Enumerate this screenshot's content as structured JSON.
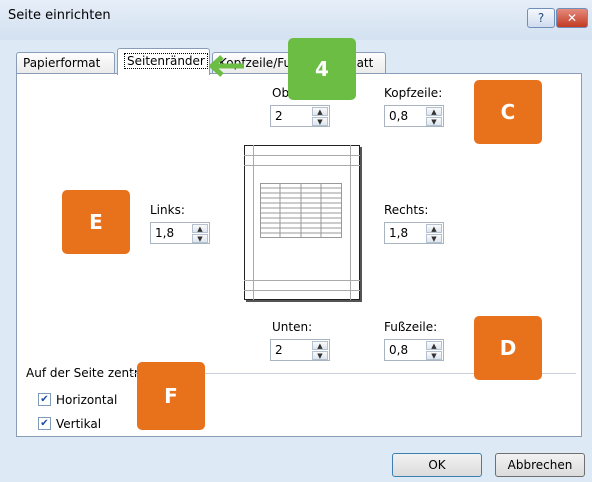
{
  "window": {
    "title": "Seite einrichten",
    "help_label": "?",
    "close_label": "✕"
  },
  "tabs": [
    {
      "label": "Papierformat"
    },
    {
      "label": "Seitenränder"
    },
    {
      "label": "Kopfzeile/Fußzeile"
    },
    {
      "label": "Blatt"
    }
  ],
  "margins": {
    "oben": {
      "label": "Oben:",
      "value": "2"
    },
    "kopfzeile": {
      "label": "Kopfzeile:",
      "value": "0,8"
    },
    "links": {
      "label": "Links:",
      "value": "1,8"
    },
    "rechts": {
      "label": "Rechts:",
      "value": "1,8"
    },
    "unten": {
      "label": "Unten:",
      "value": "2"
    },
    "fusszeile": {
      "label": "Fußzeile:",
      "value": "0,8"
    }
  },
  "center": {
    "legend": "Auf der Seite zentrieren",
    "horizontal": {
      "label": "Horizontal",
      "checked": true
    },
    "vertikal": {
      "label": "Vertikal",
      "checked": true
    }
  },
  "buttons": {
    "ok": "OK",
    "cancel": "Abbrechen"
  },
  "annotations": {
    "step": "4",
    "c": "C",
    "d": "D",
    "e": "E",
    "f": "F"
  },
  "colors": {
    "badge_orange": "#e8711c",
    "badge_green": "#6cbd43"
  },
  "icons": {
    "arrow": "left-arrow-icon",
    "spin_up": "spin-up-icon",
    "spin_down": "spin-down-icon",
    "check": "checkbox-check-icon"
  }
}
